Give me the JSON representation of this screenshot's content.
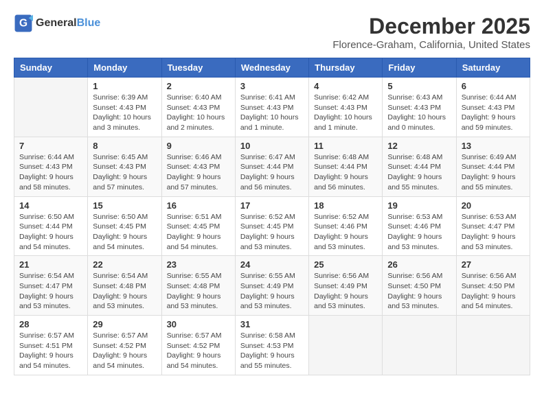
{
  "header": {
    "logo_general": "General",
    "logo_blue": "Blue",
    "month_title": "December 2025",
    "location": "Florence-Graham, California, United States"
  },
  "calendar": {
    "days_of_week": [
      "Sunday",
      "Monday",
      "Tuesday",
      "Wednesday",
      "Thursday",
      "Friday",
      "Saturday"
    ],
    "weeks": [
      [
        {
          "day": "",
          "info": ""
        },
        {
          "day": "1",
          "info": "Sunrise: 6:39 AM\nSunset: 4:43 PM\nDaylight: 10 hours\nand 3 minutes."
        },
        {
          "day": "2",
          "info": "Sunrise: 6:40 AM\nSunset: 4:43 PM\nDaylight: 10 hours\nand 2 minutes."
        },
        {
          "day": "3",
          "info": "Sunrise: 6:41 AM\nSunset: 4:43 PM\nDaylight: 10 hours\nand 1 minute."
        },
        {
          "day": "4",
          "info": "Sunrise: 6:42 AM\nSunset: 4:43 PM\nDaylight: 10 hours\nand 1 minute."
        },
        {
          "day": "5",
          "info": "Sunrise: 6:43 AM\nSunset: 4:43 PM\nDaylight: 10 hours\nand 0 minutes."
        },
        {
          "day": "6",
          "info": "Sunrise: 6:44 AM\nSunset: 4:43 PM\nDaylight: 9 hours\nand 59 minutes."
        }
      ],
      [
        {
          "day": "7",
          "info": "Sunrise: 6:44 AM\nSunset: 4:43 PM\nDaylight: 9 hours\nand 58 minutes."
        },
        {
          "day": "8",
          "info": "Sunrise: 6:45 AM\nSunset: 4:43 PM\nDaylight: 9 hours\nand 57 minutes."
        },
        {
          "day": "9",
          "info": "Sunrise: 6:46 AM\nSunset: 4:43 PM\nDaylight: 9 hours\nand 57 minutes."
        },
        {
          "day": "10",
          "info": "Sunrise: 6:47 AM\nSunset: 4:44 PM\nDaylight: 9 hours\nand 56 minutes."
        },
        {
          "day": "11",
          "info": "Sunrise: 6:48 AM\nSunset: 4:44 PM\nDaylight: 9 hours\nand 56 minutes."
        },
        {
          "day": "12",
          "info": "Sunrise: 6:48 AM\nSunset: 4:44 PM\nDaylight: 9 hours\nand 55 minutes."
        },
        {
          "day": "13",
          "info": "Sunrise: 6:49 AM\nSunset: 4:44 PM\nDaylight: 9 hours\nand 55 minutes."
        }
      ],
      [
        {
          "day": "14",
          "info": "Sunrise: 6:50 AM\nSunset: 4:44 PM\nDaylight: 9 hours\nand 54 minutes."
        },
        {
          "day": "15",
          "info": "Sunrise: 6:50 AM\nSunset: 4:45 PM\nDaylight: 9 hours\nand 54 minutes."
        },
        {
          "day": "16",
          "info": "Sunrise: 6:51 AM\nSunset: 4:45 PM\nDaylight: 9 hours\nand 54 minutes."
        },
        {
          "day": "17",
          "info": "Sunrise: 6:52 AM\nSunset: 4:45 PM\nDaylight: 9 hours\nand 53 minutes."
        },
        {
          "day": "18",
          "info": "Sunrise: 6:52 AM\nSunset: 4:46 PM\nDaylight: 9 hours\nand 53 minutes."
        },
        {
          "day": "19",
          "info": "Sunrise: 6:53 AM\nSunset: 4:46 PM\nDaylight: 9 hours\nand 53 minutes."
        },
        {
          "day": "20",
          "info": "Sunrise: 6:53 AM\nSunset: 4:47 PM\nDaylight: 9 hours\nand 53 minutes."
        }
      ],
      [
        {
          "day": "21",
          "info": "Sunrise: 6:54 AM\nSunset: 4:47 PM\nDaylight: 9 hours\nand 53 minutes."
        },
        {
          "day": "22",
          "info": "Sunrise: 6:54 AM\nSunset: 4:48 PM\nDaylight: 9 hours\nand 53 minutes."
        },
        {
          "day": "23",
          "info": "Sunrise: 6:55 AM\nSunset: 4:48 PM\nDaylight: 9 hours\nand 53 minutes."
        },
        {
          "day": "24",
          "info": "Sunrise: 6:55 AM\nSunset: 4:49 PM\nDaylight: 9 hours\nand 53 minutes."
        },
        {
          "day": "25",
          "info": "Sunrise: 6:56 AM\nSunset: 4:49 PM\nDaylight: 9 hours\nand 53 minutes."
        },
        {
          "day": "26",
          "info": "Sunrise: 6:56 AM\nSunset: 4:50 PM\nDaylight: 9 hours\nand 53 minutes."
        },
        {
          "day": "27",
          "info": "Sunrise: 6:56 AM\nSunset: 4:50 PM\nDaylight: 9 hours\nand 54 minutes."
        }
      ],
      [
        {
          "day": "28",
          "info": "Sunrise: 6:57 AM\nSunset: 4:51 PM\nDaylight: 9 hours\nand 54 minutes."
        },
        {
          "day": "29",
          "info": "Sunrise: 6:57 AM\nSunset: 4:52 PM\nDaylight: 9 hours\nand 54 minutes."
        },
        {
          "day": "30",
          "info": "Sunrise: 6:57 AM\nSunset: 4:52 PM\nDaylight: 9 hours\nand 54 minutes."
        },
        {
          "day": "31",
          "info": "Sunrise: 6:58 AM\nSunset: 4:53 PM\nDaylight: 9 hours\nand 55 minutes."
        },
        {
          "day": "",
          "info": ""
        },
        {
          "day": "",
          "info": ""
        },
        {
          "day": "",
          "info": ""
        }
      ]
    ]
  }
}
